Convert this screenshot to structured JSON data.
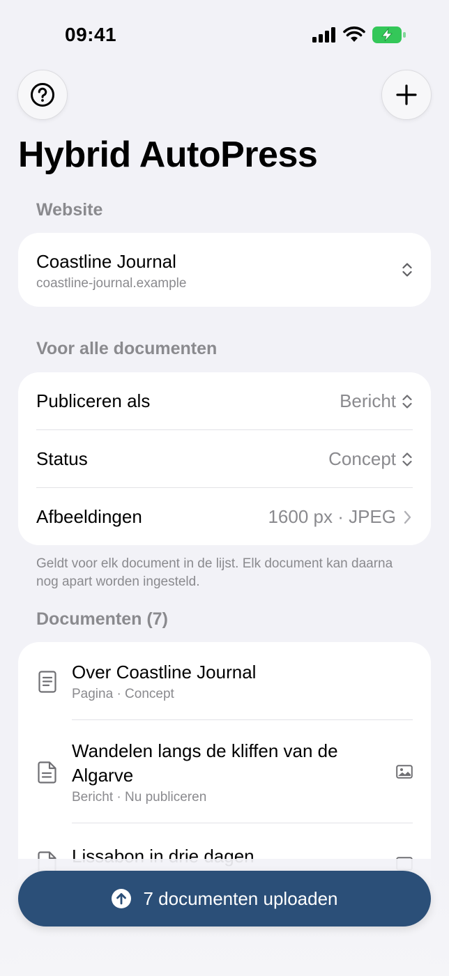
{
  "status_bar": {
    "time": "09:41"
  },
  "header": {
    "title": "Hybrid AutoPress"
  },
  "website_section": {
    "header": "Website",
    "site_name": "Coastline Journal",
    "site_url": "coastline-journal.example"
  },
  "settings_section": {
    "header": "Voor alle documenten",
    "rows": [
      {
        "label": "Publiceren als",
        "value": "Bericht"
      },
      {
        "label": "Status",
        "value": "Concept"
      },
      {
        "label": "Afbeeldingen",
        "value": "1600 px · JPEG"
      }
    ],
    "footnote": "Geldt voor elk document in de lijst. Elk document kan daarna nog apart worden ingesteld."
  },
  "documents_section": {
    "header": "Documenten (7)",
    "items": [
      {
        "title": "Over Coastline Journal",
        "meta": "Pagina · Concept",
        "icon": "page-icon"
      },
      {
        "title": "Wandelen langs de kliffen van de Algarve",
        "meta": "Bericht · Nu publiceren",
        "icon": "document-icon"
      },
      {
        "title": "Lissabon in drie dagen",
        "meta": "",
        "icon": "document-icon"
      }
    ]
  },
  "upload_button": {
    "label": "7 documenten uploaden"
  },
  "colors": {
    "accent": "#2b4f78",
    "background": "#f2f2f7",
    "battery": "#34c759"
  }
}
